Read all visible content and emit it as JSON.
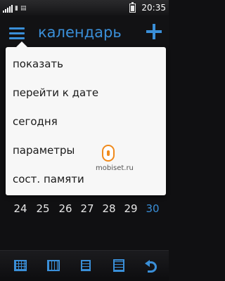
{
  "status_bar": {
    "indicators": [
      "signal-icon",
      "sim-icon",
      "network-icon"
    ],
    "time": "20:35",
    "battery_level": 0.75
  },
  "header": {
    "title": "календарь",
    "menu_icon": "menu-icon",
    "add_icon": "plus-icon"
  },
  "menu": {
    "items": [
      {
        "label": "показать"
      },
      {
        "label": "перейти к дате"
      },
      {
        "label": "сегодня"
      },
      {
        "label": "параметры"
      },
      {
        "label": "сост. памяти"
      }
    ]
  },
  "watermark": {
    "text": "mobiset.ru"
  },
  "calendar": {
    "dates": [
      "24",
      "25",
      "26",
      "27",
      "28",
      "29",
      "30"
    ],
    "highlighted_index": 6
  },
  "toolbar": {
    "icons": [
      "month-view-icon",
      "week-view-icon",
      "list-view-icon",
      "notes-icon",
      "back-icon"
    ]
  },
  "colors": {
    "accent": "#3a8fd8",
    "background": "#101012",
    "menu_background": "#f7f7f7",
    "watermark_accent": "#f08a1c"
  }
}
